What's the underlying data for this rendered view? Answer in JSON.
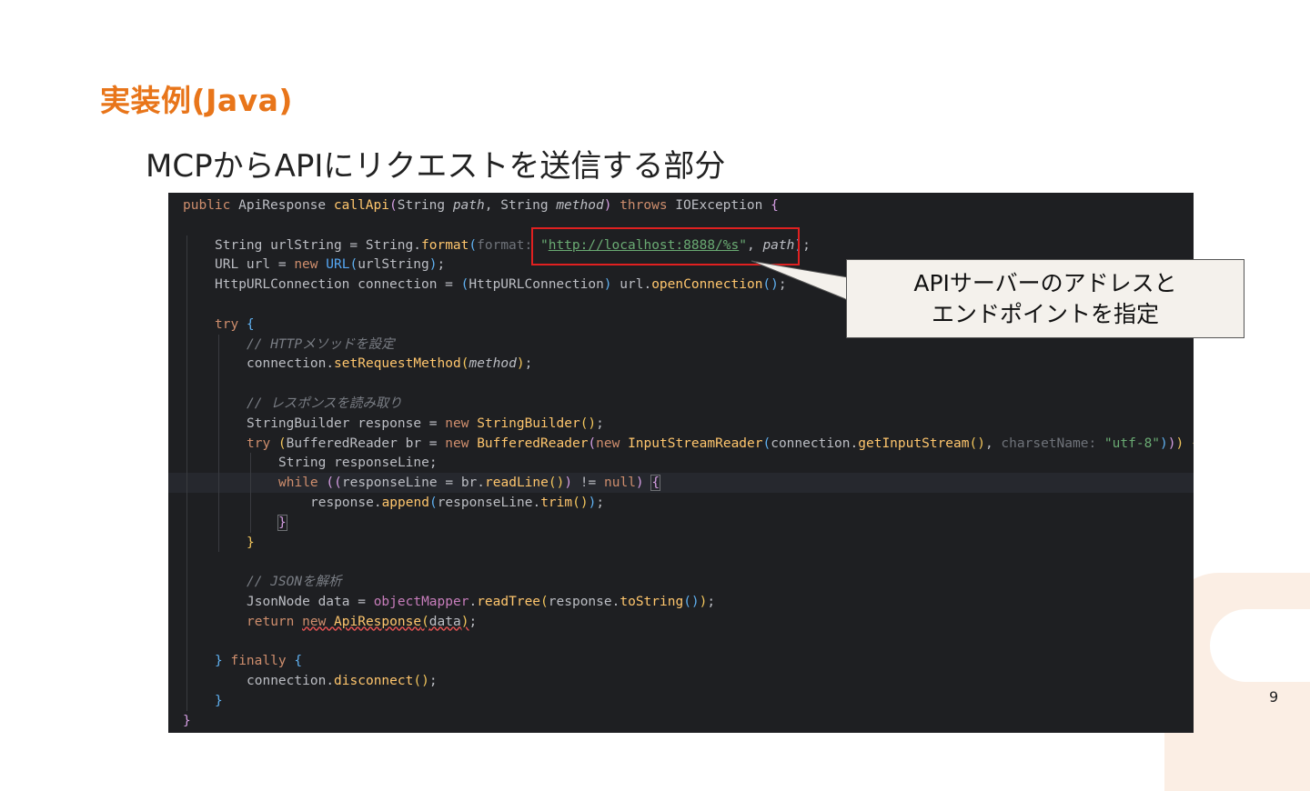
{
  "slide": {
    "title": "実装例(Java)",
    "subtitle": "MCPからAPIにリクエストを送信する部分",
    "page_number": "9"
  },
  "callout": {
    "line1": "APIサーバーのアドレスと",
    "line2": "エンドポイントを指定"
  },
  "code": {
    "language": "Java",
    "theme": "dark",
    "lines": [
      {
        "segs": [
          [
            "public ",
            "kw"
          ],
          [
            "ApiResponse ",
            ""
          ],
          [
            "callApi",
            "m"
          ],
          [
            "(",
            "pp"
          ],
          [
            "String ",
            ""
          ],
          [
            "path",
            "it"
          ],
          [
            ", ",
            ""
          ],
          [
            "String ",
            ""
          ],
          [
            "method",
            "it"
          ],
          [
            ") ",
            "pp"
          ],
          [
            "throws ",
            "kw"
          ],
          [
            "IOException ",
            ""
          ],
          [
            "{",
            "pp"
          ]
        ]
      },
      {
        "segs": []
      },
      {
        "indent": 1,
        "segs": [
          [
            "String ",
            ""
          ],
          [
            "urlString",
            ""
          ],
          [
            " = ",
            ""
          ],
          [
            "String",
            ""
          ],
          [
            ".",
            ""
          ],
          [
            "format",
            "m"
          ],
          [
            "(",
            "pb"
          ],
          [
            "format: ",
            "hint"
          ],
          [
            "\"",
            "str"
          ],
          [
            "http://localhost:8888/%s",
            "url"
          ],
          [
            "\"",
            "str"
          ],
          [
            ", ",
            ""
          ],
          [
            "path",
            "it"
          ],
          [
            ")",
            "pb"
          ],
          [
            ";",
            ""
          ]
        ]
      },
      {
        "indent": 1,
        "segs": [
          [
            "URL ",
            ""
          ],
          [
            "url",
            ""
          ],
          [
            " = ",
            ""
          ],
          [
            "new ",
            "kw"
          ],
          [
            "URL",
            "fn"
          ],
          [
            "(",
            "pb"
          ],
          [
            "urlString",
            ""
          ],
          [
            ")",
            "pb"
          ],
          [
            ";",
            ""
          ]
        ]
      },
      {
        "indent": 1,
        "segs": [
          [
            "HttpURLConnection ",
            ""
          ],
          [
            "connection",
            ""
          ],
          [
            " = ",
            ""
          ],
          [
            "(",
            "pb"
          ],
          [
            "HttpURLConnection",
            ""
          ],
          [
            ") ",
            "pb"
          ],
          [
            "url",
            ""
          ],
          [
            ".",
            ""
          ],
          [
            "openConnection",
            "m"
          ],
          [
            "()",
            "pb"
          ],
          [
            ";",
            ""
          ]
        ]
      },
      {
        "segs": []
      },
      {
        "indent": 1,
        "segs": [
          [
            "try ",
            "kw"
          ],
          [
            "{",
            "pb"
          ]
        ]
      },
      {
        "indent": 2,
        "segs": [
          [
            "// HTTPメソッドを設定",
            "cm"
          ]
        ]
      },
      {
        "indent": 2,
        "segs": [
          [
            "connection",
            ""
          ],
          [
            ".",
            ""
          ],
          [
            "setRequestMethod",
            "m"
          ],
          [
            "(",
            "ps"
          ],
          [
            "method",
            "it"
          ],
          [
            ")",
            "ps"
          ],
          [
            ";",
            ""
          ]
        ]
      },
      {
        "segs": []
      },
      {
        "indent": 2,
        "segs": [
          [
            "// レスポンスを読み取り",
            "cm"
          ]
        ]
      },
      {
        "indent": 2,
        "segs": [
          [
            "StringBuilder ",
            ""
          ],
          [
            "response",
            ""
          ],
          [
            " = ",
            ""
          ],
          [
            "new ",
            "kw"
          ],
          [
            "StringBuilder",
            "m"
          ],
          [
            "()",
            "ps"
          ],
          [
            ";",
            ""
          ]
        ]
      },
      {
        "indent": 2,
        "segs": [
          [
            "try ",
            "kw"
          ],
          [
            "(",
            "ps"
          ],
          [
            "BufferedReader ",
            ""
          ],
          [
            "br",
            ""
          ],
          [
            " = ",
            ""
          ],
          [
            "new ",
            "kw"
          ],
          [
            "BufferedReader",
            "m"
          ],
          [
            "(",
            "pp"
          ],
          [
            "new ",
            "kw"
          ],
          [
            "InputStreamReader",
            "m"
          ],
          [
            "(",
            "pb"
          ],
          [
            "connection",
            ""
          ],
          [
            ".",
            ""
          ],
          [
            "getInputStream",
            "m"
          ],
          [
            "()",
            "ps"
          ],
          [
            ", ",
            ""
          ],
          [
            "charsetName: ",
            "hint"
          ],
          [
            "\"utf-8\"",
            "str"
          ],
          [
            ")",
            "pb"
          ],
          [
            ")",
            "pp"
          ],
          [
            ") ",
            "ps"
          ],
          [
            "{",
            "ps"
          ]
        ]
      },
      {
        "indent": 3,
        "segs": [
          [
            "String ",
            ""
          ],
          [
            "responseLine",
            ""
          ],
          [
            ";",
            ""
          ]
        ]
      },
      {
        "indent": 3,
        "current": true,
        "segs": [
          [
            "while ",
            "kw"
          ],
          [
            "((",
            "pp"
          ],
          [
            "responseLine",
            ""
          ],
          [
            " = ",
            ""
          ],
          [
            "br",
            ""
          ],
          [
            ".",
            ""
          ],
          [
            "readLine",
            "m"
          ],
          [
            "()",
            "ps"
          ],
          [
            ")",
            "pp"
          ],
          [
            " != ",
            ""
          ],
          [
            "null",
            "kw"
          ],
          [
            ") ",
            "pp"
          ],
          [
            "{",
            "box"
          ]
        ]
      },
      {
        "indent": 4,
        "segs": [
          [
            "response",
            ""
          ],
          [
            ".",
            ""
          ],
          [
            "append",
            "m"
          ],
          [
            "(",
            "pb"
          ],
          [
            "responseLine",
            ""
          ],
          [
            ".",
            ""
          ],
          [
            "trim",
            "m"
          ],
          [
            "()",
            "ps"
          ],
          [
            ")",
            "pb"
          ],
          [
            ";",
            ""
          ]
        ]
      },
      {
        "indent": 3,
        "segs": [
          [
            "}",
            "box"
          ]
        ]
      },
      {
        "indent": 2,
        "segs": [
          [
            "}",
            "ps"
          ]
        ]
      },
      {
        "segs": []
      },
      {
        "indent": 2,
        "segs": [
          [
            "// JSONを解析",
            "cm"
          ]
        ]
      },
      {
        "indent": 2,
        "segs": [
          [
            "JsonNode ",
            ""
          ],
          [
            "data",
            ""
          ],
          [
            " = ",
            ""
          ],
          [
            "objectMapper",
            "obj"
          ],
          [
            ".",
            ""
          ],
          [
            "readTree",
            "m"
          ],
          [
            "(",
            "ps"
          ],
          [
            "response",
            ""
          ],
          [
            ".",
            ""
          ],
          [
            "toString",
            "m"
          ],
          [
            "()",
            "pb"
          ],
          [
            ")",
            "ps"
          ],
          [
            ";",
            ""
          ]
        ]
      },
      {
        "indent": 2,
        "segs": [
          [
            "return ",
            "kw"
          ],
          [
            "new ",
            "kw-err"
          ],
          [
            "ApiResponse",
            "m-err"
          ],
          [
            "(",
            "ps-err"
          ],
          [
            "data",
            "err"
          ],
          [
            ")",
            "ps-err"
          ],
          [
            ";",
            ""
          ]
        ]
      },
      {
        "segs": []
      },
      {
        "indent": 1,
        "segs": [
          [
            "} ",
            "pb"
          ],
          [
            "finally ",
            "kw"
          ],
          [
            "{",
            "pb"
          ]
        ]
      },
      {
        "indent": 2,
        "segs": [
          [
            "connection",
            ""
          ],
          [
            ".",
            ""
          ],
          [
            "disconnect",
            "m"
          ],
          [
            "()",
            "ps"
          ],
          [
            ";",
            ""
          ]
        ]
      },
      {
        "indent": 1,
        "segs": [
          [
            "}",
            "pb"
          ]
        ]
      },
      {
        "segs": [
          [
            "}",
            "pp"
          ]
        ]
      }
    ]
  }
}
